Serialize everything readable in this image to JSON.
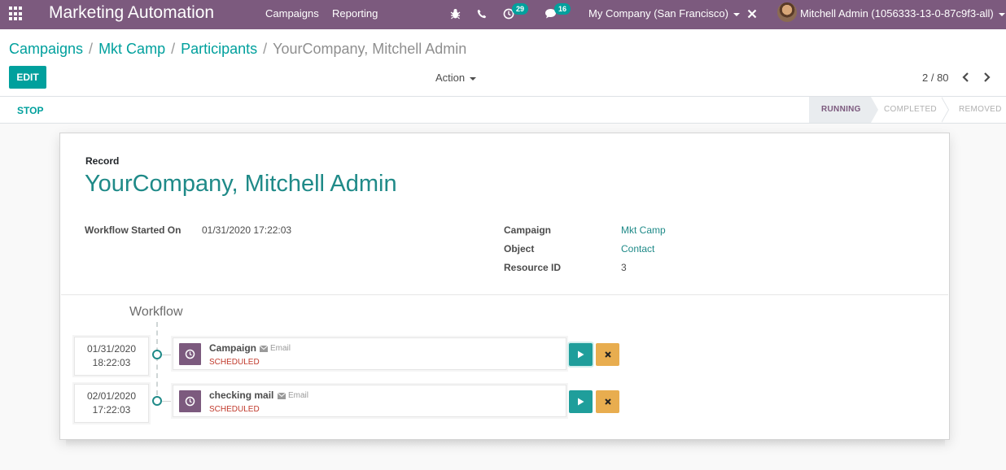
{
  "navbar": {
    "brand": "Marketing Automation",
    "menu": [
      "Campaigns",
      "Reporting"
    ],
    "activity_count": "29",
    "message_count": "16",
    "company": "My Company (San Francisco)",
    "user": "Mitchell Admin (1056333-13-0-87c9f3-all)"
  },
  "breadcrumb": {
    "items": [
      "Campaigns",
      "Mkt Camp",
      "Participants"
    ],
    "separator": "/",
    "current": "YourCompany, Mitchell Admin"
  },
  "control_panel": {
    "edit_label": "EDIT",
    "action_label": "Action",
    "pager": "2 / 80"
  },
  "statusbar": {
    "stop_label": "STOP",
    "stages": [
      "RUNNING",
      "COMPLETED",
      "REMOVED"
    ],
    "active_stage": "RUNNING"
  },
  "record": {
    "label": "Record",
    "title": "YourCompany, Mitchell Admin"
  },
  "fields": {
    "workflow_started_label": "Workflow Started On",
    "workflow_started_value": "01/31/2020 17:22:03",
    "campaign_label": "Campaign",
    "campaign_value": "Mkt Camp",
    "object_label": "Object",
    "object_value": "Contact",
    "resource_label": "Resource ID",
    "resource_value": "3"
  },
  "workflow": {
    "title": "Workflow",
    "items": [
      {
        "date": "01/31/2020",
        "time": "18:22:03",
        "name": "Campaign",
        "type": "Email",
        "status": "SCHEDULED"
      },
      {
        "date": "02/01/2020",
        "time": "17:22:03",
        "name": "checking mail",
        "type": "Email",
        "status": "SCHEDULED"
      }
    ]
  },
  "colors": {
    "navbar": "#7c5a7e",
    "primary": "#00a09d",
    "link": "#1f8a88",
    "scheduled": "#c0392b",
    "cancel": "#e8ad4f"
  }
}
